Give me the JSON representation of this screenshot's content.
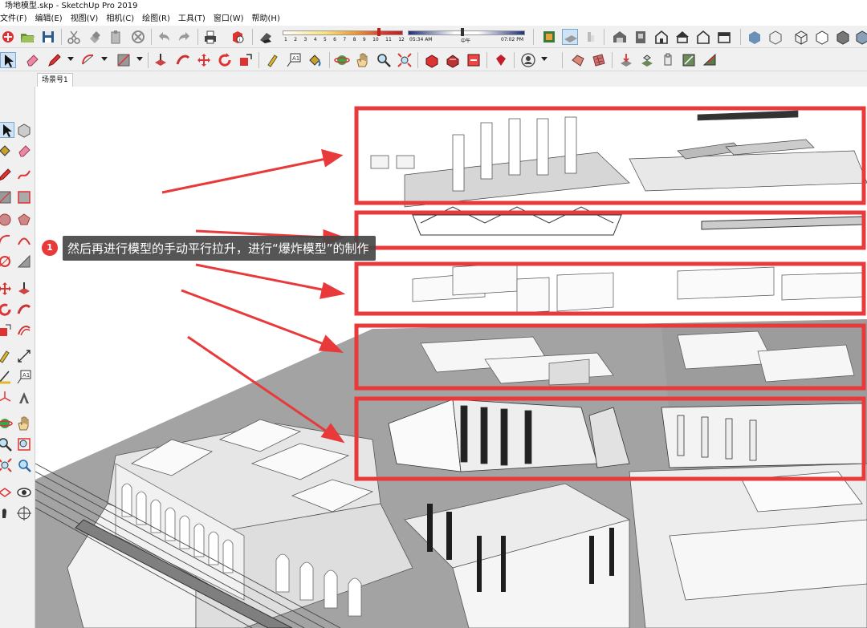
{
  "window": {
    "title": "场地模型.skp - SketchUp Pro 2019"
  },
  "menu": [
    "文件(F)",
    "编辑(E)",
    "视图(V)",
    "相机(C)",
    "绘图(R)",
    "工具(T)",
    "窗口(W)",
    "帮助(H)"
  ],
  "shadow": {
    "month_ticks": [
      "1",
      "2",
      "3",
      "4",
      "5",
      "6",
      "7",
      "8",
      "9",
      "10",
      "11",
      "12"
    ],
    "time_start": "05:34 AM",
    "time_mid": "中午",
    "time_end": "07:02 PM"
  },
  "scene_tab": "场景号1",
  "callout": {
    "number": "1",
    "text": "然后再进行模型的手动平行拉升，进行“爆炸模型”的制作"
  },
  "colors": {
    "highlight_red": "#e8393b",
    "ground_gray": "#a3a3a3",
    "callout_bg": "#464646"
  },
  "toolbar_row1_icons": [
    "new-icon",
    "open-icon",
    "save-icon",
    "cut-icon",
    "copy-icon",
    "paste-icon",
    "erase-icon",
    "undo-icon",
    "redo-icon",
    "print-icon",
    "model-info-icon",
    "shadows-icon",
    "iso-view-icon",
    "top-view-icon",
    "front-view-icon",
    "right-view-icon",
    "back-view-icon",
    "left-view-icon",
    "xray-icon",
    "back-edges-icon",
    "wireframe-icon",
    "hidden-line-icon",
    "shaded-icon",
    "textured-icon",
    "monochrome-icon"
  ],
  "toolbar_row2_icons": [
    "select-icon",
    "eraser-icon",
    "pencil-icon",
    "arc-icon",
    "rectangle-icon",
    "push-pull-icon",
    "follow-me-icon",
    "move-icon",
    "rotate-icon",
    "scale-icon",
    "tape-measure-icon",
    "text-icon",
    "paint-bucket-icon",
    "orbit-icon",
    "pan-icon",
    "zoom-icon",
    "zoom-extents-icon",
    "warehouse-icon",
    "extension-icon",
    "send-layout-icon",
    "ruby-icon",
    "user-icon",
    "sandbox-icon",
    "grid-icon",
    "stamp-icon",
    "drape-icon",
    "add-detail-icon",
    "flip-edge-icon"
  ]
}
